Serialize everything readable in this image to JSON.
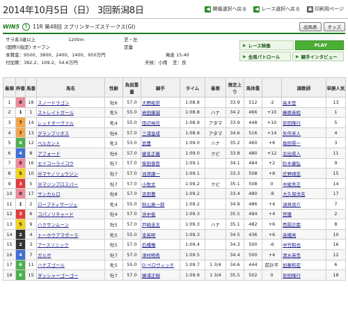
{
  "header": {
    "title": "2014年10月5日（日） 3回新潟8日",
    "nav": [
      {
        "label": "開催選択へ戻る",
        "icon": "back-arrow-icon"
      },
      {
        "label": "レース選択へ戻る",
        "icon": "back-arrow-icon"
      },
      {
        "label": "印刷用ページ",
        "icon": "printer-icon"
      }
    ]
  },
  "race": {
    "logo": "WIN5",
    "win5_number": "5",
    "name": "11R 第48回 スプリンターズステークス(GⅠ)",
    "buttons": [
      "出馬表",
      "オッズ"
    ]
  },
  "info": {
    "line1": "サラ系3歳以上",
    "distance": "1200m",
    "surface": "芝・左",
    "line2": "(国際)(指定) オープン",
    "weight_rule": "定量",
    "line3": "本賞金：9500、3800、2400、1400、950万円",
    "start_time": "発走 15:40",
    "line4": "付加賞：382.2、109.2、54.6万円",
    "weather": "天候：小雨",
    "track": "芝：良"
  },
  "media": {
    "video": "レース映像",
    "play": "PLAY",
    "patrol": "全周パトロール",
    "interview": "騎手インタビュー"
  },
  "columns": [
    "着順",
    "枠番",
    "馬番",
    "馬名",
    "性齢",
    "負担重量",
    "騎手",
    "タイム",
    "着差",
    "推定上り",
    "馬体重",
    "",
    "調教師",
    "単勝人気"
  ],
  "results": [
    {
      "rank": "1",
      "waku": "8",
      "wakucolor": "#f08a9b",
      "num": "18",
      "horse": "スノードラゴン",
      "sex": "牡6",
      "wt": "57.0",
      "jockey": "大野拓弥",
      "time": "1:08.8",
      "margin": "",
      "last": "33.9",
      "body": "512",
      "diff": "-2",
      "trainer": "高木登",
      "pop": "13"
    },
    {
      "rank": "2",
      "waku": "1",
      "wakucolor": "#ffffff",
      "num": "1",
      "horse": "ストレイトガール",
      "sex": "牝5",
      "wt": "55.0",
      "jockey": "岩田康誠",
      "time": "1:08.8",
      "margin": "ハナ",
      "last": "34.2",
      "body": "466",
      "diff": "+10",
      "trainer": "藤原英昭",
      "pop": "1"
    },
    {
      "rank": "3",
      "waku": "7",
      "wakucolor": "#f4a64a",
      "num": "14",
      "horse": "レッドオーヴァル",
      "sex": "牝4",
      "wt": "55.0",
      "jockey": "田辺裕信",
      "time": "1:08.9",
      "margin": "アタマ",
      "last": "33.9",
      "body": "448",
      "diff": "+10",
      "trainer": "安田隆行",
      "pop": "5"
    },
    {
      "rank": "4",
      "waku": "7",
      "wakucolor": "#f4a64a",
      "num": "13",
      "horse": "グランプリボス",
      "sex": "牡6",
      "wt": "57.0",
      "jockey": "三浦皇成",
      "time": "1:08.9",
      "margin": "アタマ",
      "last": "34.6",
      "body": "516",
      "diff": "+14",
      "trainer": "矢作芳人",
      "pop": "4"
    },
    {
      "rank": "5",
      "waku": "6",
      "wakucolor": "#4caf50",
      "num": "12",
      "horse": "ベルカント",
      "sex": "牝3",
      "wt": "53.0",
      "jockey": "武豊",
      "time": "1:09.0",
      "margin": "ハナ",
      "last": "35.2",
      "body": "460",
      "diff": "+6",
      "trainer": "角田晃一",
      "pop": "3"
    },
    {
      "rank": "6",
      "waku": "4",
      "wakucolor": "#3f6fd6",
      "num": "8",
      "horse": "アフォード",
      "sex": "牡6",
      "wt": "57.0",
      "jockey": "蛯名正義",
      "time": "1:09.0",
      "margin": "クビ",
      "last": "33.8",
      "body": "480",
      "diff": "+12",
      "trainer": "北出成人",
      "pop": "11"
    },
    {
      "rank": "7",
      "waku": "8",
      "wakucolor": "#f08a9b",
      "num": "16",
      "horse": "セイコーライコウ",
      "sex": "牡7",
      "wt": "57.0",
      "jockey": "柴田善臣",
      "time": "1:09.1",
      "margin": "",
      "last": "34.1",
      "body": "484",
      "diff": "+2",
      "trainer": "鈴木康弘",
      "pop": "9"
    },
    {
      "rank": "8",
      "waku": "5",
      "wakucolor": "#f2d21c",
      "num": "10",
      "horse": "Ⓜマヤノリュウジン",
      "sex": "牡7",
      "wt": "57.0",
      "jockey": "池添謙一",
      "time": "1:09.1",
      "margin": "",
      "last": "33.3",
      "body": "508",
      "diff": "+8",
      "trainer": "庄野靖志",
      "pop": "15"
    },
    {
      "rank": "9",
      "waku": "3",
      "wakucolor": "#e23b3b",
      "num": "5",
      "horse": "Ⓜマジンプロスパー",
      "sex": "牡7",
      "wt": "57.0",
      "jockey": "小牧太",
      "time": "1:09.2",
      "margin": "クビ",
      "last": "35.1",
      "body": "508",
      "diff": "0",
      "trainer": "中尾秀正",
      "pop": "14"
    },
    {
      "rank": "10",
      "waku": "8",
      "wakucolor": "#f08a9b",
      "num": "17",
      "horse": "サンカルロ",
      "sex": "牡8",
      "wt": "57.0",
      "jockey": "吉田豊",
      "time": "1:09.2",
      "margin": "",
      "last": "33.4",
      "body": "480",
      "diff": "-8",
      "trainer": "大久保洋吉",
      "pop": "17"
    },
    {
      "rank": "11",
      "waku": "1",
      "wakucolor": "#ffffff",
      "num": "2",
      "horse": "ローブティサージュ",
      "sex": "牝4",
      "wt": "55.0",
      "jockey": "秋山真一郎",
      "time": "1:09.2",
      "margin": "",
      "last": "34.9",
      "body": "486",
      "diff": "+4",
      "trainer": "須貝尚介",
      "pop": "7"
    },
    {
      "rank": "12",
      "waku": "3",
      "wakucolor": "#e23b3b",
      "num": "6",
      "horse": "コパノリチャード",
      "sex": "牡4",
      "wt": "57.0",
      "jockey": "浜中俊",
      "time": "1:09.3",
      "margin": "",
      "last": "35.5",
      "body": "494",
      "diff": "+4",
      "trainer": "宮徹",
      "pop": "2"
    },
    {
      "rank": "13",
      "waku": "5",
      "wakucolor": "#f2d21c",
      "num": "9",
      "horse": "ハクサンムーン",
      "sex": "牡5",
      "wt": "57.0",
      "jockey": "戸崎圭太",
      "time": "1:09.3",
      "margin": "ハナ",
      "last": "35.1",
      "body": "482",
      "diff": "+6",
      "trainer": "西園正都",
      "pop": "8"
    },
    {
      "rank": "14",
      "waku": "2",
      "wakucolor": "#333333",
      "num": "4",
      "horse": "トーホウアマポーラ",
      "sex": "牝5",
      "wt": "55.0",
      "jockey": "幸英明",
      "time": "1:09.3",
      "margin": "",
      "last": "34.5",
      "body": "436",
      "diff": "+6",
      "trainer": "高橋亮",
      "pop": "10"
    },
    {
      "rank": "15",
      "waku": "2",
      "wakucolor": "#333333",
      "num": "3",
      "horse": "アースソニック",
      "sex": "牡5",
      "wt": "57.0",
      "jockey": "石橋脩",
      "time": "1:09.4",
      "margin": "",
      "last": "34.3",
      "body": "500",
      "diff": "-6",
      "trainer": "中竹和也",
      "pop": "16"
    },
    {
      "rank": "16",
      "waku": "4",
      "wakucolor": "#3f6fd6",
      "num": "7",
      "horse": "ガルボ",
      "sex": "牡7",
      "wt": "57.0",
      "jockey": "津村明秀",
      "time": "1:09.5",
      "margin": "",
      "last": "34.4",
      "body": "500",
      "diff": "+4",
      "trainer": "清水英克",
      "pop": "12"
    },
    {
      "rank": "17",
      "waku": "6",
      "wakucolor": "#4caf50",
      "num": "11",
      "horse": "ハナズゴール",
      "sex": "牝5",
      "wt": "55.0",
      "jockey": "D.ベロヴィッチ",
      "time": "1:09.7",
      "margin": "1 3/4",
      "last": "34.6",
      "body": "444",
      "diff": "前計不",
      "trainer": "加藤和宏",
      "pop": "6"
    },
    {
      "rank": "18",
      "waku": "6",
      "wakucolor": "#4caf50",
      "num": "15",
      "horse": "ダッシャーゴーゴー",
      "sex": "牡7",
      "wt": "57.0",
      "jockey": "勝浦正樹",
      "time": "1:09.9",
      "margin": "1 3/4",
      "last": "35.5",
      "body": "502",
      "diff": "0",
      "trainer": "安田隆行",
      "pop": "18"
    }
  ],
  "colors": {
    "accent": "#1a7a1a",
    "link": "#1a1a8a"
  }
}
